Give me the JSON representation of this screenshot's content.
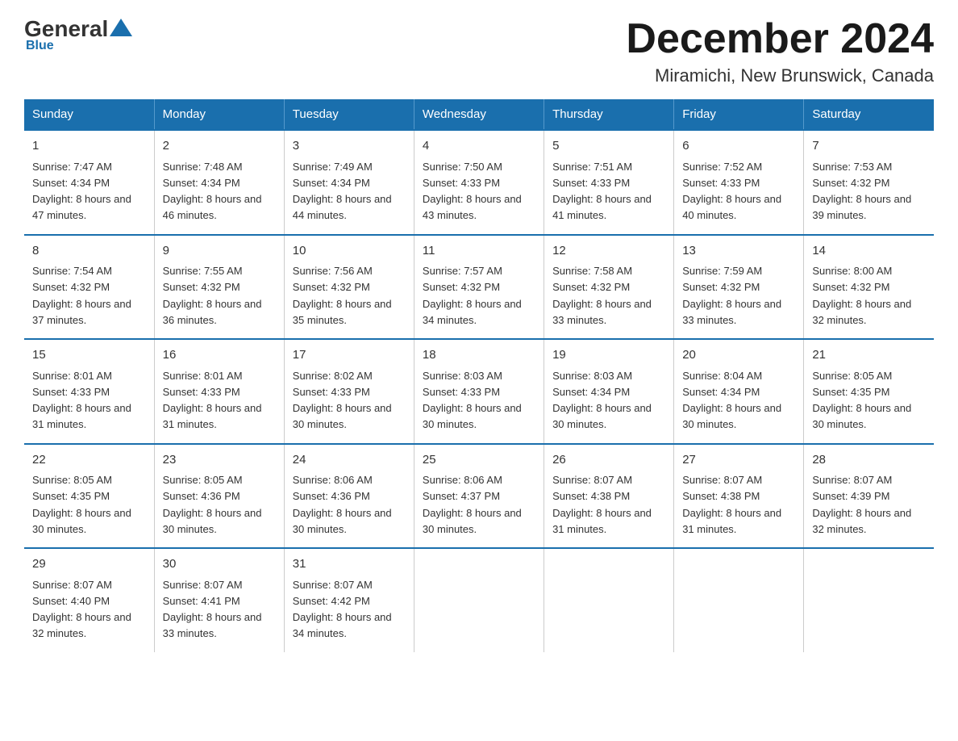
{
  "header": {
    "logo": {
      "general": "General",
      "blue": "Blue",
      "underline": "Blue"
    },
    "title": "December 2024",
    "location": "Miramichi, New Brunswick, Canada"
  },
  "days_of_week": [
    "Sunday",
    "Monday",
    "Tuesday",
    "Wednesday",
    "Thursday",
    "Friday",
    "Saturday"
  ],
  "weeks": [
    [
      {
        "day": "1",
        "sunrise": "7:47 AM",
        "sunset": "4:34 PM",
        "daylight": "8 hours and 47 minutes."
      },
      {
        "day": "2",
        "sunrise": "7:48 AM",
        "sunset": "4:34 PM",
        "daylight": "8 hours and 46 minutes."
      },
      {
        "day": "3",
        "sunrise": "7:49 AM",
        "sunset": "4:34 PM",
        "daylight": "8 hours and 44 minutes."
      },
      {
        "day": "4",
        "sunrise": "7:50 AM",
        "sunset": "4:33 PM",
        "daylight": "8 hours and 43 minutes."
      },
      {
        "day": "5",
        "sunrise": "7:51 AM",
        "sunset": "4:33 PM",
        "daylight": "8 hours and 41 minutes."
      },
      {
        "day": "6",
        "sunrise": "7:52 AM",
        "sunset": "4:33 PM",
        "daylight": "8 hours and 40 minutes."
      },
      {
        "day": "7",
        "sunrise": "7:53 AM",
        "sunset": "4:32 PM",
        "daylight": "8 hours and 39 minutes."
      }
    ],
    [
      {
        "day": "8",
        "sunrise": "7:54 AM",
        "sunset": "4:32 PM",
        "daylight": "8 hours and 37 minutes."
      },
      {
        "day": "9",
        "sunrise": "7:55 AM",
        "sunset": "4:32 PM",
        "daylight": "8 hours and 36 minutes."
      },
      {
        "day": "10",
        "sunrise": "7:56 AM",
        "sunset": "4:32 PM",
        "daylight": "8 hours and 35 minutes."
      },
      {
        "day": "11",
        "sunrise": "7:57 AM",
        "sunset": "4:32 PM",
        "daylight": "8 hours and 34 minutes."
      },
      {
        "day": "12",
        "sunrise": "7:58 AM",
        "sunset": "4:32 PM",
        "daylight": "8 hours and 33 minutes."
      },
      {
        "day": "13",
        "sunrise": "7:59 AM",
        "sunset": "4:32 PM",
        "daylight": "8 hours and 33 minutes."
      },
      {
        "day": "14",
        "sunrise": "8:00 AM",
        "sunset": "4:32 PM",
        "daylight": "8 hours and 32 minutes."
      }
    ],
    [
      {
        "day": "15",
        "sunrise": "8:01 AM",
        "sunset": "4:33 PM",
        "daylight": "8 hours and 31 minutes."
      },
      {
        "day": "16",
        "sunrise": "8:01 AM",
        "sunset": "4:33 PM",
        "daylight": "8 hours and 31 minutes."
      },
      {
        "day": "17",
        "sunrise": "8:02 AM",
        "sunset": "4:33 PM",
        "daylight": "8 hours and 30 minutes."
      },
      {
        "day": "18",
        "sunrise": "8:03 AM",
        "sunset": "4:33 PM",
        "daylight": "8 hours and 30 minutes."
      },
      {
        "day": "19",
        "sunrise": "8:03 AM",
        "sunset": "4:34 PM",
        "daylight": "8 hours and 30 minutes."
      },
      {
        "day": "20",
        "sunrise": "8:04 AM",
        "sunset": "4:34 PM",
        "daylight": "8 hours and 30 minutes."
      },
      {
        "day": "21",
        "sunrise": "8:05 AM",
        "sunset": "4:35 PM",
        "daylight": "8 hours and 30 minutes."
      }
    ],
    [
      {
        "day": "22",
        "sunrise": "8:05 AM",
        "sunset": "4:35 PM",
        "daylight": "8 hours and 30 minutes."
      },
      {
        "day": "23",
        "sunrise": "8:05 AM",
        "sunset": "4:36 PM",
        "daylight": "8 hours and 30 minutes."
      },
      {
        "day": "24",
        "sunrise": "8:06 AM",
        "sunset": "4:36 PM",
        "daylight": "8 hours and 30 minutes."
      },
      {
        "day": "25",
        "sunrise": "8:06 AM",
        "sunset": "4:37 PM",
        "daylight": "8 hours and 30 minutes."
      },
      {
        "day": "26",
        "sunrise": "8:07 AM",
        "sunset": "4:38 PM",
        "daylight": "8 hours and 31 minutes."
      },
      {
        "day": "27",
        "sunrise": "8:07 AM",
        "sunset": "4:38 PM",
        "daylight": "8 hours and 31 minutes."
      },
      {
        "day": "28",
        "sunrise": "8:07 AM",
        "sunset": "4:39 PM",
        "daylight": "8 hours and 32 minutes."
      }
    ],
    [
      {
        "day": "29",
        "sunrise": "8:07 AM",
        "sunset": "4:40 PM",
        "daylight": "8 hours and 32 minutes."
      },
      {
        "day": "30",
        "sunrise": "8:07 AM",
        "sunset": "4:41 PM",
        "daylight": "8 hours and 33 minutes."
      },
      {
        "day": "31",
        "sunrise": "8:07 AM",
        "sunset": "4:42 PM",
        "daylight": "8 hours and 34 minutes."
      },
      null,
      null,
      null,
      null
    ]
  ],
  "labels": {
    "sunrise": "Sunrise:",
    "sunset": "Sunset:",
    "daylight": "Daylight:"
  }
}
